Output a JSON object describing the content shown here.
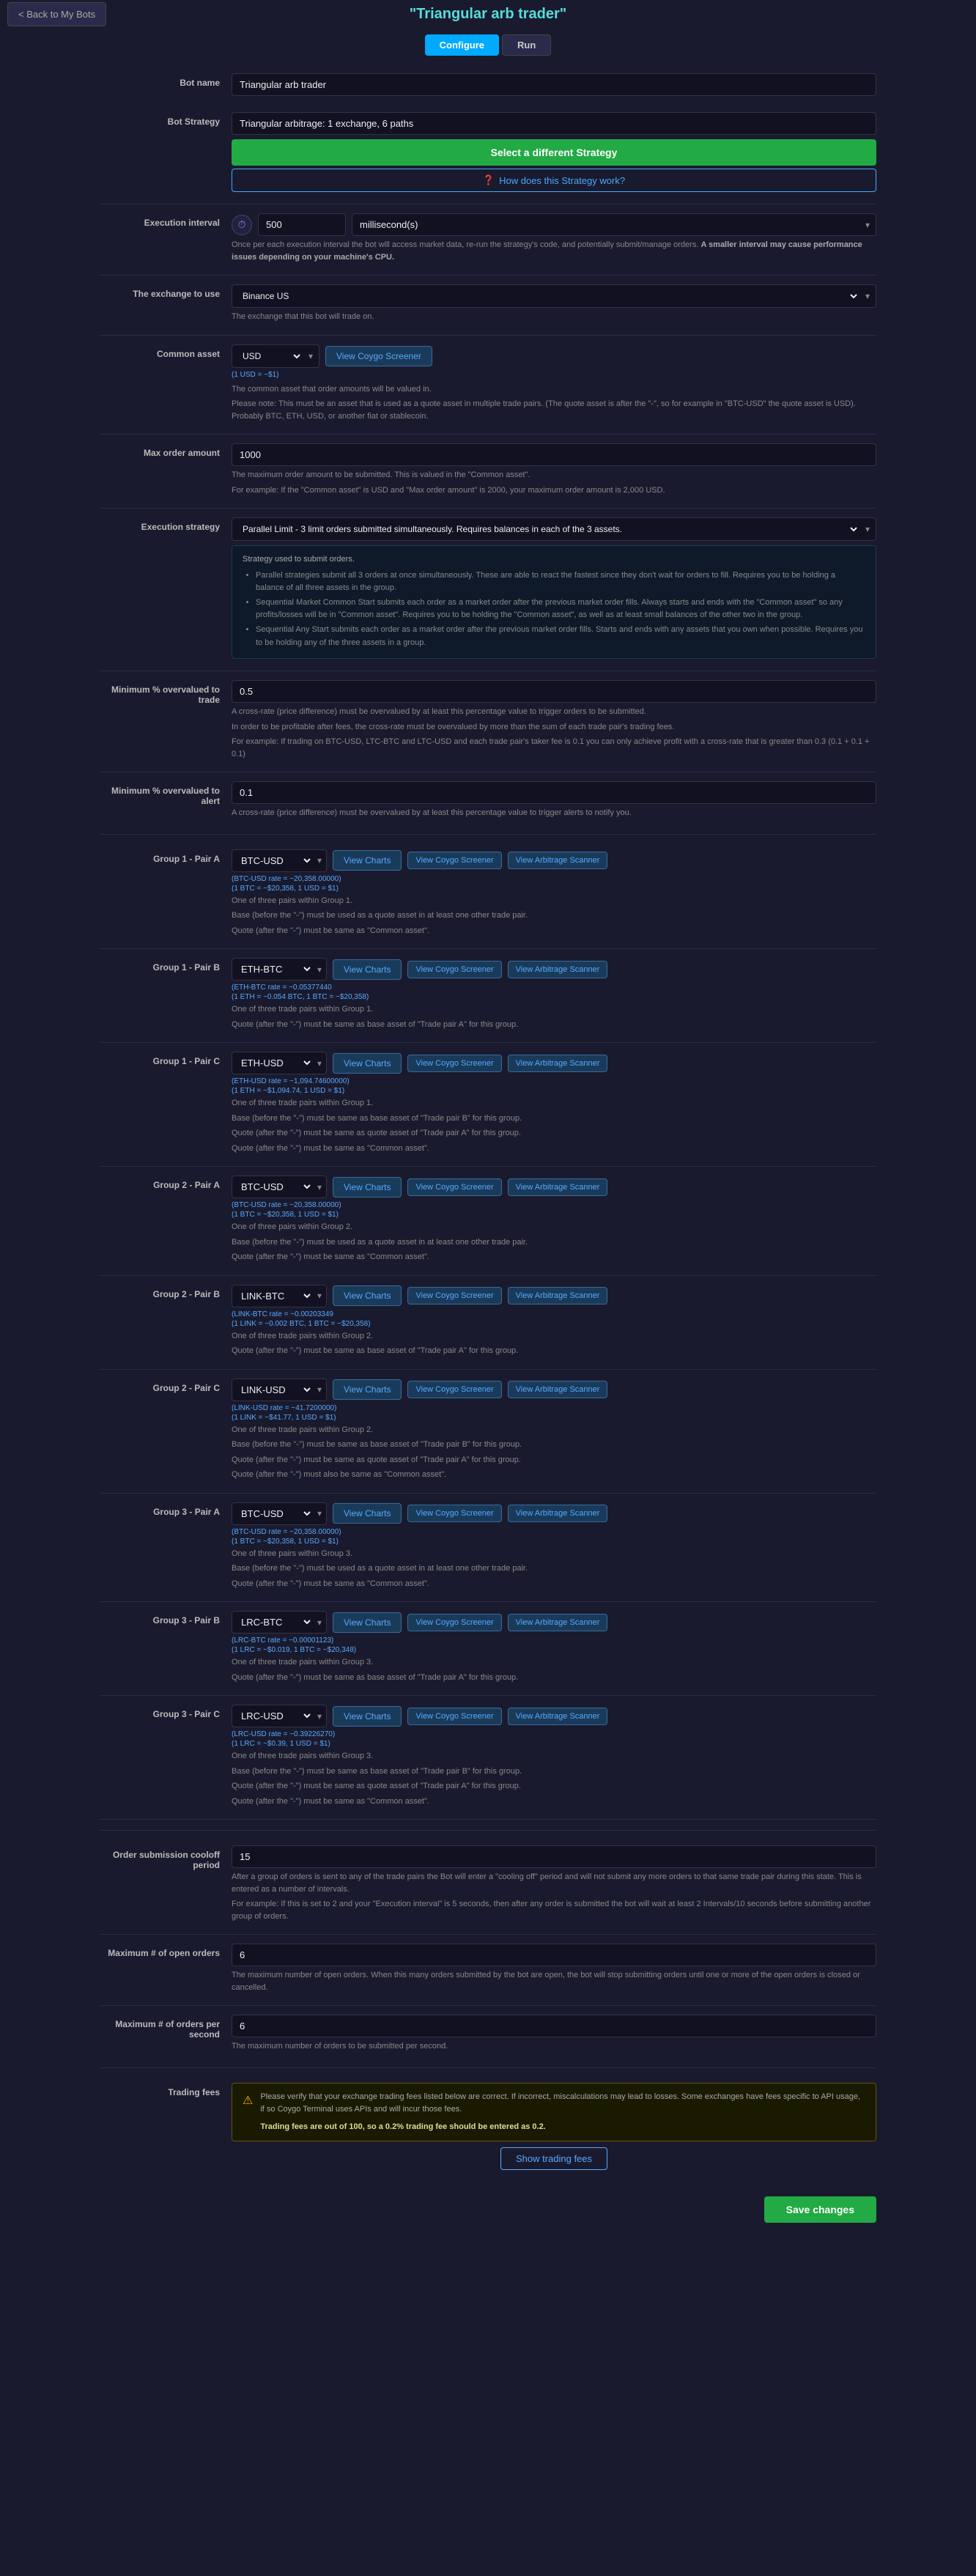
{
  "tabs": {
    "configure": "Configure",
    "run": "Run",
    "active": "configure"
  },
  "header": {
    "back_label": "< Back to My Bots",
    "title": "\"Triangular arb trader\""
  },
  "bot_name": {
    "label": "Bot name",
    "value": "Triangular arb trader"
  },
  "bot_strategy": {
    "label": "Bot Strategy",
    "value": "Triangular arbitrage: 1 exchange, 6 paths",
    "select_btn": "Select a different Strategy",
    "how_btn_icon": "❓",
    "how_btn": "How does this Strategy work?"
  },
  "execution_interval": {
    "label": "Execution interval",
    "value": "500",
    "unit": "millisecond(s)",
    "hint": "Once per each execution interval the bot will access market data, re-run the strategy's code, and potentially submit/manage orders.",
    "hint_bold": "A smaller interval may cause performance issues depending on your machine's CPU."
  },
  "exchange": {
    "label": "The exchange to use",
    "value": "Binance US",
    "hint": "The exchange that this bot will trade on."
  },
  "common_asset": {
    "label": "Common asset",
    "value": "USD",
    "rate": "(1 USD = ~$1)",
    "view_coygo_btn": "View Coygo Screener",
    "hint1": "The common asset that order amounts will be valued in.",
    "hint2": "Please note: This must be an asset that is used as a quote asset in multiple trade pairs. (The quote asset is after the \"-\", so for example in \"BTC-USD\" the quote asset is USD). Probably BTC, ETH, USD, or another fiat or stablecoin."
  },
  "max_order_amount": {
    "label": "Max order amount",
    "value": "1000",
    "hint1": "The maximum order amount to be submitted. This is valued in the \"Common asset\".",
    "hint2": "For example: If the \"Common asset\" is USD and \"Max order amount\" is 2000, your maximum order amount is 2,000 USD."
  },
  "execution_strategy": {
    "label": "Execution strategy",
    "value": "Parallel Limit - 3 limit orders submitted simultaneously. Requires balances in each of the 3 assets.",
    "strategy_used": "Strategy used to submit orders.",
    "bullets": [
      "Parallel strategies submit all 3 orders at once simultaneously. These are able to react the fastest since they don't wait for orders to fill. Requires you to be holding a balance of all three assets in the group.",
      "Sequential Market Common Start submits each order as a market order after the previous market order fills. Always starts and ends with the \"Common asset\" so any profits/losses will be in \"Common asset\". Requires you to be holding the \"Common asset\", as well as at least small balances of the other two in the group.",
      "Sequential Any Start submits each order as a market order after the previous market order fills. Starts and ends with any assets that you own when possible. Requires you to be holding any of the three assets in a group."
    ]
  },
  "min_overvalued_to_trade": {
    "label": "Minimum % overvalued to trade",
    "value": "0.5",
    "hint1": "A cross-rate (price difference) must be overvalued by at least this percentage value to trigger orders to be submitted.",
    "hint2": "In order to be profitable after fees, the cross-rate must be overvalued by more than the sum of each trade pair's trading fees.",
    "hint3": "For example: If trading on BTC-USD, LTC-BTC and LTC-USD and each trade pair's taker fee is 0.1 you can only achieve profit with a cross-rate that is greater than 0.3 (0.1 + 0.1 + 0.1)"
  },
  "min_overvalued_to_alert": {
    "label": "Minimum % overvalued to alert",
    "value": "0.1",
    "hint": "A cross-rate (price difference) must be overvalued by at least this percentage value to trigger alerts to notify you."
  },
  "groups": [
    {
      "id": "group1_pairA",
      "label": "Group 1 - Pair A",
      "pair": "BTC-USD",
      "rate_line1": "(BTC-USD rate = ~20,358.00000)",
      "rate_line2": "(1 BTC = ~$20,358, 1 USD = $1)",
      "view_charts": "View Charts",
      "view_coygo": "View Coygo Screener",
      "view_arb": "View Arbitrage Scanner",
      "hint1": "One of three pairs within Group 1.",
      "hint2": "Base (before the \"-\") must be used as a quote asset in at least one other trade pair.",
      "hint3": "Quote (after the \"-\") must be same as \"Common asset\"."
    },
    {
      "id": "group1_pairB",
      "label": "Group 1 - Pair B",
      "pair": "ETH-BTC",
      "rate_line1": "(ETH-BTC rate = ~0.05377440",
      "rate_line2": "(1 ETH = ~0.054 BTC, 1 BTC = ~$20,358)",
      "view_charts": "View Charts",
      "view_coygo": "View Coygo Screener",
      "view_arb": "View Arbitrage Scanner",
      "hint1": "One of three trade pairs within Group 1.",
      "hint2": "Quote (after the \"-\") must be same as base asset of \"Trade pair A\" for this group."
    },
    {
      "id": "group1_pairC",
      "label": "Group 1 - Pair C",
      "pair": "ETH-USD",
      "rate_line1": "(ETH-USD rate = ~1,094.74600000)",
      "rate_line2": "(1 ETH = ~$1,094.74, 1 USD = $1)",
      "view_charts": "View Charts",
      "view_coygo": "View Coygo Screener",
      "view_arb": "View Arbitrage Scanner",
      "hint1": "One of three trade pairs within Group 1.",
      "hint2": "Base (before the \"-\") must be same as base asset of \"Trade pair B\" for this group.",
      "hint3": "Quote (after the \"-\") must be same as quote asset of \"Trade pair A\" for this group.",
      "hint4": "Quote (after the \"-\") must be same as \"Common asset\"."
    },
    {
      "id": "group2_pairA",
      "label": "Group 2 - Pair A",
      "pair": "BTC-USD",
      "rate_line1": "(BTC-USD rate = ~20,358.00000)",
      "rate_line2": "(1 BTC = ~$20,358, 1 USD = $1)",
      "view_charts": "View Charts",
      "view_coygo": "View Coygo Screener",
      "view_arb": "View Arbitrage Scanner",
      "hint1": "One of three pairs within Group 2.",
      "hint2": "Base (before the \"-\") must be used as a quote asset in at least one other trade pair.",
      "hint3": "Quote (after the \"-\") must be same as \"Common asset\"."
    },
    {
      "id": "group2_pairB",
      "label": "Group 2 - Pair B",
      "pair": "LINK-BTC",
      "rate_line1": "(LINK-BTC rate = ~0.00203349",
      "rate_line2": "(1 LINK = ~0.002 BTC, 1 BTC = ~$20,358)",
      "view_charts": "View Charts",
      "view_coygo": "View Coygo Screener",
      "view_arb": "View Arbitrage Scanner",
      "hint1": "One of three trade pairs within Group 2.",
      "hint2": "Quote (after the \"-\") must be same as base asset of \"Trade pair A\" for this group."
    },
    {
      "id": "group2_pairC",
      "label": "Group 2 - Pair C",
      "pair": "LINK-USD",
      "rate_line1": "(LINK-USD rate = ~41.7200000)",
      "rate_line2": "(1 LINK = ~$41.77, 1 USD = $1)",
      "view_charts": "View Charts",
      "view_coygo": "View Coygo Screener",
      "view_arb": "View Arbitrage Scanner",
      "hint1": "One of three trade pairs within Group 2.",
      "hint2": "Base (before the \"-\") must be same as base asset of \"Trade pair B\" for this group.",
      "hint3": "Quote (after the \"-\") must be same as quote asset of \"Trade pair A\" for this group.",
      "hint4": "Quote (after the \"-\") must also be same as \"Common asset\"."
    },
    {
      "id": "group3_pairA",
      "label": "Group 3 - Pair A",
      "pair": "BTC-USD",
      "rate_line1": "(BTC-USD rate = ~20,358.00000)",
      "rate_line2": "(1 BTC = ~$20,358, 1 USD = $1)",
      "view_charts": "View Charts",
      "view_coygo": "View Coygo Screener",
      "view_arb": "View Arbitrage Scanner",
      "hint1": "One of three pairs within Group 3.",
      "hint2": "Base (before the \"-\") must be used as a quote asset in at least one other trade pair.",
      "hint3": "Quote (after the \"-\") must be same as \"Common asset\"."
    },
    {
      "id": "group3_pairB",
      "label": "Group 3 - Pair B",
      "pair": "LRC-BTC",
      "rate_line1": "(LRC-BTC rate = ~0.00001123)",
      "rate_line2": "(1 LRC = ~$0.019, 1 BTC = ~$20,348)",
      "view_charts": "View Charts",
      "view_coygo": "View Coygo Screener",
      "view_arb": "View Arbitrage Scanner",
      "hint1": "One of three trade pairs within Group 3.",
      "hint2": "Quote (after the \"-\") must be same as base asset of \"Trade pair A\" for this group."
    },
    {
      "id": "group3_pairC",
      "label": "Group 3 - Pair C",
      "pair": "LRC-USD",
      "rate_line1": "(LRC-USD rate = ~0.39226270)",
      "rate_line2": "(1 LRC = ~$0.39, 1 USD = $1)",
      "view_charts": "View Charts",
      "view_coygo": "View Coygo Screener",
      "view_arb": "View Arbitrage Scanner",
      "hint1": "One of three trade pairs within Group 3.",
      "hint2": "Base (before the \"-\") must be same as base asset of \"Trade pair B\" for this group.",
      "hint3": "Quote (after the \"-\") must be same as quote asset of \"Trade pair A\" for this group.",
      "hint4": "Quote (after the \"-\") must be same as \"Common asset\"."
    }
  ],
  "order_submission_cooloff": {
    "label": "Order submission cooloff period",
    "value": "15",
    "hint1": "After a group of orders is sent to any of the trade pairs the Bot will enter a \"cooling off\" period and will not submit any more orders to that same trade pair during this state. This is entered as a number of intervals.",
    "hint2_example": "For example: If this is set to 2 and your \"Execution interval\" is 5 seconds, then after any order is submitted the bot will wait at least 2 Intervals/10 seconds before submitting another group of orders."
  },
  "max_open_orders": {
    "label": "Maximum # of open orders",
    "value": "6",
    "hint": "The maximum number of open orders. When this many orders submitted by the bot are open, the bot will stop submitting orders until one or more of the open orders is closed or cancelled."
  },
  "max_orders_per_second": {
    "label": "Maximum # of orders per second",
    "value": "6",
    "hint": "The maximum number of orders to be submitted per second."
  },
  "trading_fees": {
    "label": "Trading fees",
    "warning": "Please verify that your exchange trading fees listed below are correct. If incorrect, miscalculations may lead to losses. Some exchanges have fees specific to API usage, if so Coygo Terminal uses APIs and will incur those fees.",
    "warning_note": "Trading fees are out of 100, so a 0.2% trading fee should be entered as 0.2.",
    "show_btn": "Show trading fees"
  },
  "save": {
    "label": "Save changes"
  }
}
